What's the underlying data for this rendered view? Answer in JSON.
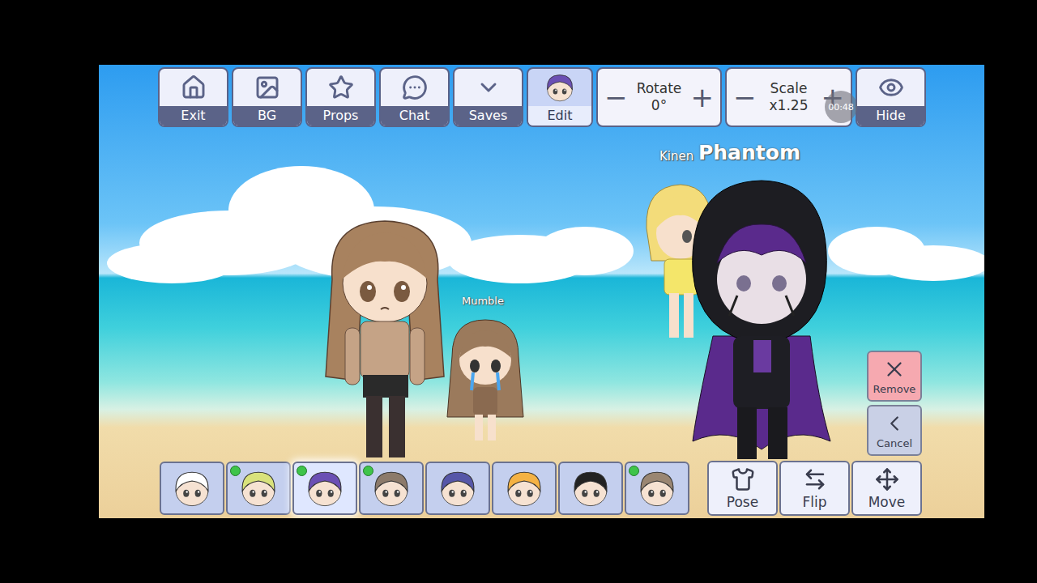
{
  "toolbar": [
    {
      "label": "Exit",
      "selected": false
    },
    {
      "label": "BG",
      "selected": false
    },
    {
      "label": "Props",
      "selected": false
    },
    {
      "label": "Chat",
      "selected": false
    },
    {
      "label": "Saves",
      "selected": false
    },
    {
      "label": "Edit",
      "selected": true
    }
  ],
  "controls": [
    {
      "label": "Rotate",
      "value": "0°",
      "decrease": "−",
      "increase": "+"
    },
    {
      "label": "Scale",
      "value": "x1.25",
      "decrease": "−",
      "increase": "+"
    }
  ],
  "hide": {
    "label": "Hide"
  },
  "timer": "00:48",
  "characters": [
    {
      "name": "Mumble",
      "kind": "chibi",
      "color": "#9b7a5c"
    },
    {
      "name": "Kinen",
      "kind": "blonde",
      "color": "#f3dc7a"
    },
    {
      "name": "Phantom",
      "kind": "hooded",
      "color": "#5a2a8c"
    },
    {
      "name": "",
      "kind": "girl",
      "color": "#a8825f"
    }
  ],
  "side_buttons": [
    {
      "label": "Remove",
      "color": "#f6a9b0"
    },
    {
      "label": "Cancel",
      "color": "#c9d0e6"
    }
  ],
  "slots": [
    {
      "color": "#ffffff",
      "active": false,
      "selected": false
    },
    {
      "color": "#d9e27c",
      "active": true,
      "selected": false
    },
    {
      "color": "#6b4fb4",
      "active": true,
      "selected": true
    },
    {
      "color": "#8c7a6a",
      "active": true,
      "selected": false
    },
    {
      "color": "#5656a8",
      "active": false,
      "selected": false
    },
    {
      "color": "#f4b244",
      "active": false,
      "selected": false
    },
    {
      "color": "#222222",
      "active": false,
      "selected": false
    },
    {
      "color": "#9a8672",
      "active": true,
      "selected": false
    }
  ],
  "actions": [
    {
      "label": "Pose"
    },
    {
      "label": "Flip"
    },
    {
      "label": "Move"
    }
  ]
}
